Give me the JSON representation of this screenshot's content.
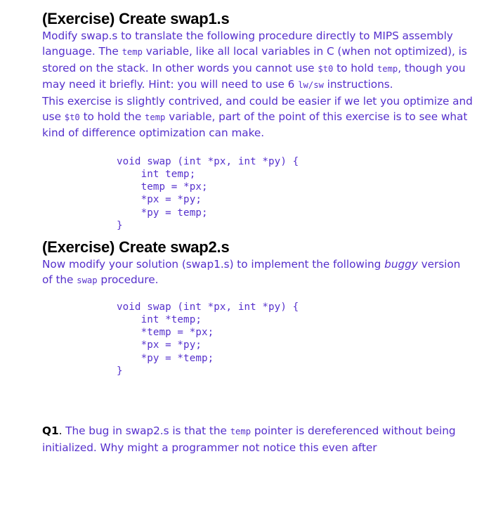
{
  "colors": {
    "body_text": "#5530cc",
    "heading_text": "#000000",
    "background": "#ffffff",
    "code_text": "#5530cc"
  },
  "sections": [
    {
      "heading": "(Exercise) Create swap1.s",
      "paragraphs": [
        {
          "id": "p1",
          "runs": [
            {
              "type": "text",
              "value": "Modify swap.s to translate the following procedure directly to MIPS assembly language. The "
            },
            {
              "type": "code",
              "value": "temp"
            },
            {
              "type": "text",
              "value": " variable, like all local variables in C (when not optimized), is stored on the stack. In other words you cannot use "
            },
            {
              "type": "code",
              "value": "$t0"
            },
            {
              "type": "text",
              "value": " to hold "
            },
            {
              "type": "code",
              "value": "temp"
            },
            {
              "type": "text",
              "value": ", though you may need it briefly. Hint: you will need to use 6 "
            },
            {
              "type": "code",
              "value": "lw/sw"
            },
            {
              "type": "text",
              "value": " instructions."
            }
          ]
        },
        {
          "id": "p2",
          "runs": [
            {
              "type": "text",
              "value": "This exercise is slightly contrived, and could be easier if we let you optimize and use "
            },
            {
              "type": "code",
              "value": "$t0"
            },
            {
              "type": "text",
              "value": " to hold the "
            },
            {
              "type": "code",
              "value": "temp"
            },
            {
              "type": "text",
              "value": " variable, part of the point of this exercise is to see what kind of difference optimization can make."
            }
          ]
        }
      ],
      "code": "void swap (int *px, int *py) {\n    int temp;\n    temp = *px;\n    *px = *py;\n    *py = temp;\n}"
    },
    {
      "heading": "(Exercise) Create swap2.s",
      "paragraphs": [
        {
          "id": "p3",
          "runs": [
            {
              "type": "text",
              "value": "Now modify your solution (swap1.s) to implement the following "
            },
            {
              "type": "italic",
              "value": "buggy"
            },
            {
              "type": "text",
              "value": " version of the "
            },
            {
              "type": "code",
              "value": "swap"
            },
            {
              "type": "text",
              "value": " procedure."
            }
          ]
        }
      ],
      "code": "void swap (int *px, int *py) {\n    int *temp;\n    *temp = *px;\n    *px = *py;\n    *py = *temp;\n}"
    }
  ],
  "question": {
    "label": "Q1",
    "separator": ".",
    "runs": [
      {
        "type": "text",
        "value": " The bug in swap2.s is that the "
      },
      {
        "type": "code",
        "value": "temp"
      },
      {
        "type": "text",
        "value": " pointer is dereferenced without being initialized. Why might a programmer not notice this even after"
      }
    ]
  }
}
